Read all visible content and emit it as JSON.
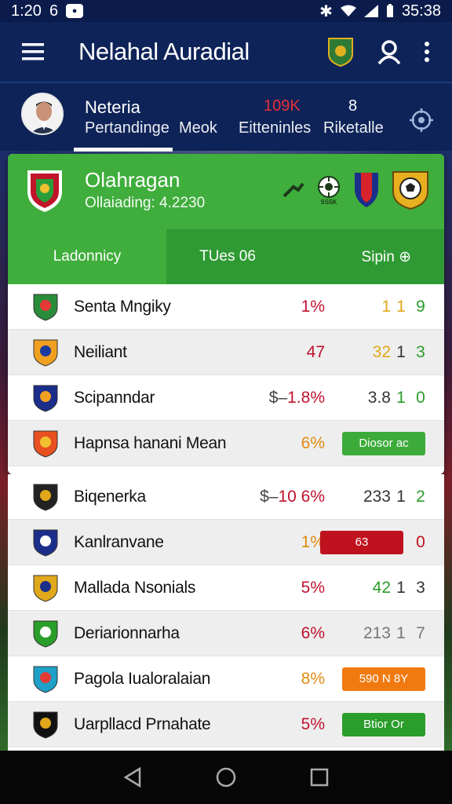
{
  "status_bar": {
    "time": "1:20",
    "extra": "6",
    "clock": "35:38"
  },
  "app_bar": {
    "title": "Nelahal Auradial"
  },
  "profile": {
    "name": "Neteria",
    "tabs": [
      "Pertandinge",
      "Meok",
      "Eitteninles",
      "Riketalle"
    ],
    "stat_red": "109K",
    "stat_white": "8"
  },
  "card": {
    "title": "Olahragan",
    "subtitle": "Ollaiading: 4.2230",
    "logo_caption": "SS5K",
    "tabs": [
      "Ladonnicy",
      "TUes 06",
      "Sipin ⊕"
    ]
  },
  "rows": [
    {
      "name": "Senta Mngiky",
      "pct": "1%",
      "pct_color": "#c0122e",
      "v1": "1",
      "v1_color": "#e0a81a",
      "v2": "1",
      "v2_color": "#e0a81a",
      "v3": "9",
      "v3_color": "#2a9d2a",
      "crest": "#2a8c3a",
      "crest2": "#e53935"
    },
    {
      "name": "Neiliant",
      "pct": "47",
      "pct_color": "#c0122e",
      "v1": "32",
      "v1_color": "#e0a81a",
      "v2": "1",
      "v2_color": "#333333",
      "v3": "3",
      "v3_color": "#2a9d2a",
      "crest": "#f0a020",
      "crest2": "#1a3aa0"
    },
    {
      "name": "Scipanndar",
      "pct_prefix": "$–",
      "pct": "1.8%",
      "pct_color": "#c0122e",
      "v1": "3.8",
      "v1_color": "#333333",
      "v2": "1",
      "v2_color": "#2a9d2a",
      "v3": "0",
      "v3_color": "#2a9d2a",
      "crest": "#1a2e8a",
      "crest2": "#f0a020"
    },
    {
      "name": "Hapnsa hanani Mean",
      "pct": "6%",
      "pct_color": "#e08a10",
      "pill": "Diosor ac",
      "pill_color": "#3cab3a",
      "crest": "#e85020",
      "crest2": "#f0c030"
    }
  ],
  "rows_lower": [
    {
      "name": "Biqenerka",
      "pct_prefix": "$–",
      "pct": "10 6%",
      "pct_color": "#c0122e",
      "v1": "233",
      "v1_color": "#333333",
      "v2": "1",
      "v2_color": "#333333",
      "v3": "2",
      "v3_color": "#2a9d2a",
      "crest": "#222222",
      "crest2": "#e0a81a"
    },
    {
      "name": "Kanlranvane",
      "pct": "1%",
      "pct_color": "#e08a10",
      "pill": "63",
      "pill_color": "#c0121e",
      "v3": "0",
      "v3_color": "#c0121e",
      "crest": "#1a2e8a",
      "crest2": "#ffffff"
    },
    {
      "name": "Mallada Nsonials",
      "pct": "5%",
      "pct_color": "#c0122e",
      "v1": "42",
      "v1_color": "#2a9d2a",
      "v2": "1",
      "v2_color": "#333333",
      "v3": "3",
      "v3_color": "#333333",
      "crest": "#e0a81a",
      "crest2": "#1a2e8a"
    },
    {
      "name": "Deriarionnarha",
      "pct": "6%",
      "pct_color": "#c0122e",
      "v1": "213",
      "v1_color": "#777777",
      "v2": "1",
      "v2_color": "#777777",
      "v3": "7",
      "v3_color": "#777777",
      "crest": "#2a9d2a",
      "crest2": "#ffffff"
    },
    {
      "name": "Pagola Iualoralaian",
      "pct": "8%",
      "pct_color": "#e08a10",
      "pill": "590 N 8Y",
      "pill_color": "#f07a10",
      "crest": "#1fa0c8",
      "crest2": "#e53935"
    },
    {
      "name": "Uarpllacd Prnahate",
      "pct": "5%",
      "pct_color": "#c0122e",
      "pill": "Btior Or",
      "pill_color": "#2a9d2a",
      "crest": "#111111",
      "crest2": "#e0a81a"
    }
  ]
}
